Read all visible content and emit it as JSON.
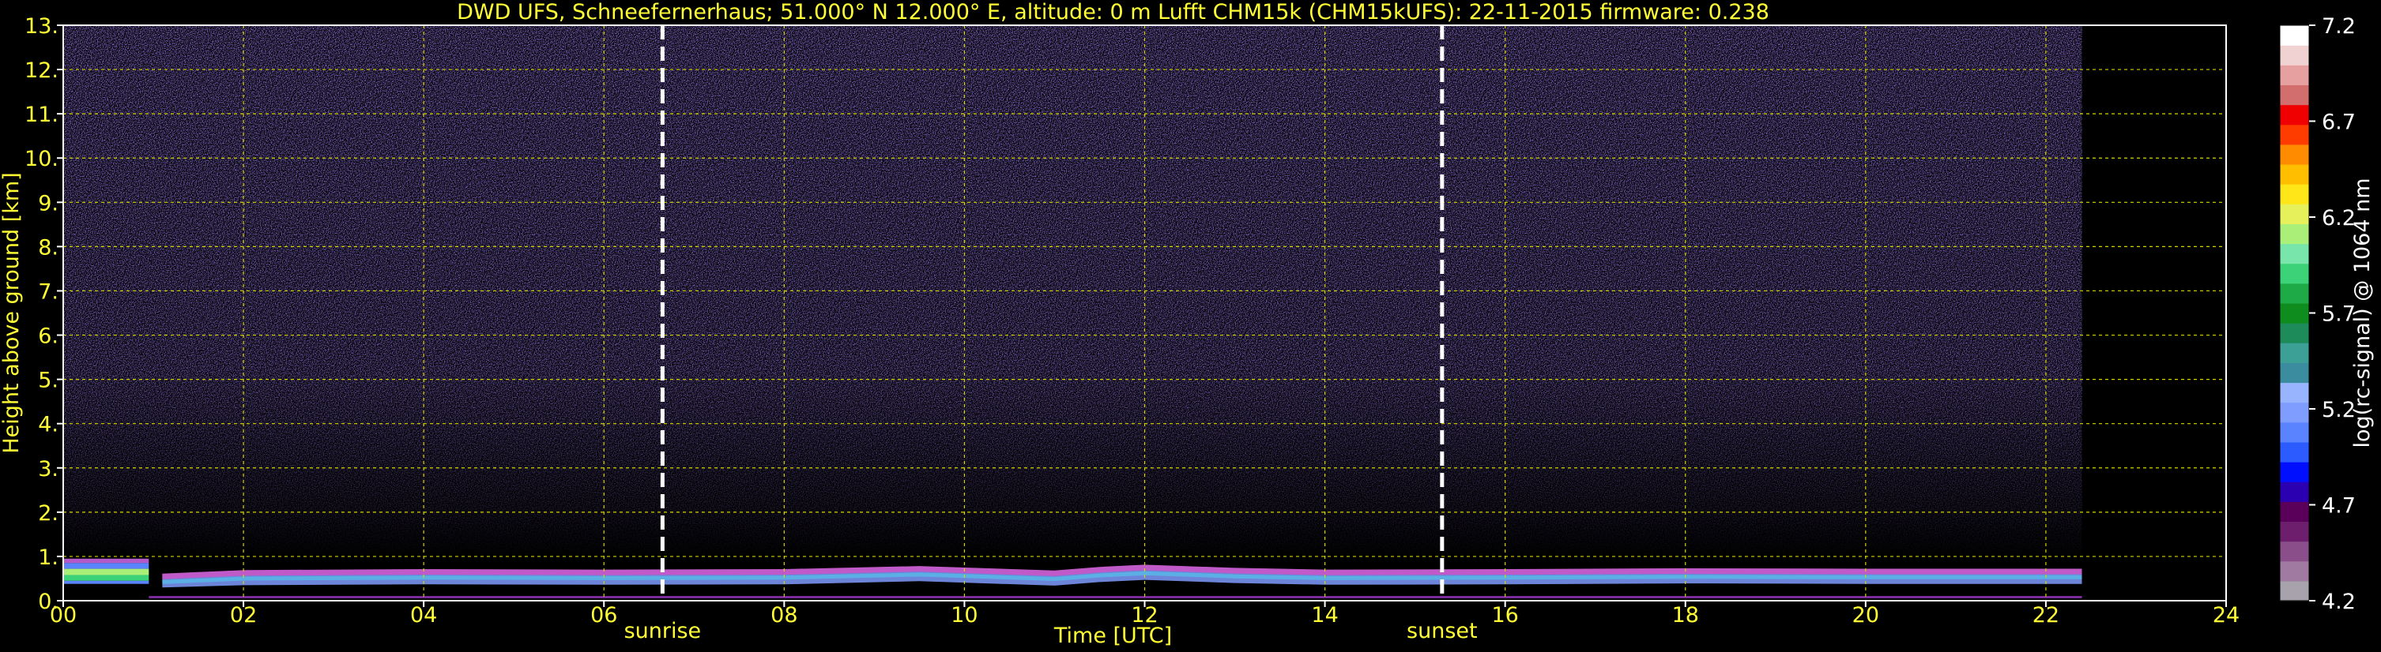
{
  "chart_data": {
    "type": "heatmap",
    "title": "DWD UFS, Schneefernerhaus; 51.000° N 12.000° E, altitude: 0 m    Lufft CHM15k (CHM15kUFS): 22-11-2015    firmware: 0.238",
    "xlabel": "Time [UTC]",
    "ylabel": "Height above ground [km]",
    "xlim": [
      0,
      24
    ],
    "ylim": [
      0,
      13
    ],
    "x_ticks": [
      "00",
      "02",
      "04",
      "06",
      "08",
      "10",
      "12",
      "14",
      "16",
      "18",
      "20",
      "22",
      "24"
    ],
    "y_ticks": [
      "0.",
      "1.",
      "2.",
      "3.",
      "4.",
      "5.",
      "6.",
      "7.",
      "8.",
      "9.",
      "10.",
      "11.",
      "12.",
      "13."
    ],
    "grid": true,
    "data_end_hour": 22.4,
    "events": [
      {
        "label": "sunrise",
        "hour": 6.65
      },
      {
        "label": "sunset",
        "hour": 15.3
      }
    ],
    "boundary_layer": [
      {
        "hour": 1.1,
        "km": 0.55
      },
      {
        "hour": 2,
        "km": 0.63
      },
      {
        "hour": 4,
        "km": 0.65
      },
      {
        "hour": 6,
        "km": 0.64
      },
      {
        "hour": 8,
        "km": 0.65
      },
      {
        "hour": 9.5,
        "km": 0.72
      },
      {
        "hour": 11,
        "km": 0.62
      },
      {
        "hour": 11.5,
        "km": 0.7
      },
      {
        "hour": 12,
        "km": 0.75
      },
      {
        "hour": 13,
        "km": 0.68
      },
      {
        "hour": 14,
        "km": 0.64
      },
      {
        "hour": 16,
        "km": 0.65
      },
      {
        "hour": 18,
        "km": 0.67
      },
      {
        "hour": 20,
        "km": 0.66
      },
      {
        "hour": 22.4,
        "km": 0.66
      }
    ],
    "colorbar": {
      "label": "log(rc-signal) @ 1064 nm",
      "ticks": [
        "4.2",
        "4.7",
        "5.2",
        "5.7",
        "6.2",
        "6.7",
        "7.2"
      ],
      "range": [
        4.2,
        7.2
      ],
      "colors": [
        "#a8a2ac",
        "#a07aa0",
        "#8a4f8a",
        "#6d1f6d",
        "#5a005a",
        "#2a00b0",
        "#0010ff",
        "#2c5cff",
        "#5a84ff",
        "#7f9cff",
        "#98b4ff",
        "#3c8ca0",
        "#3ca096",
        "#1e8c5a",
        "#0f8c1e",
        "#1eaa46",
        "#3cd278",
        "#78e6aa",
        "#aaf078",
        "#e6f05a",
        "#ffe619",
        "#ffbe00",
        "#ff8c00",
        "#ff3c00",
        "#f00000",
        "#d26e6e",
        "#e6a0a0",
        "#f0d2d2",
        "#ffffff"
      ]
    }
  }
}
